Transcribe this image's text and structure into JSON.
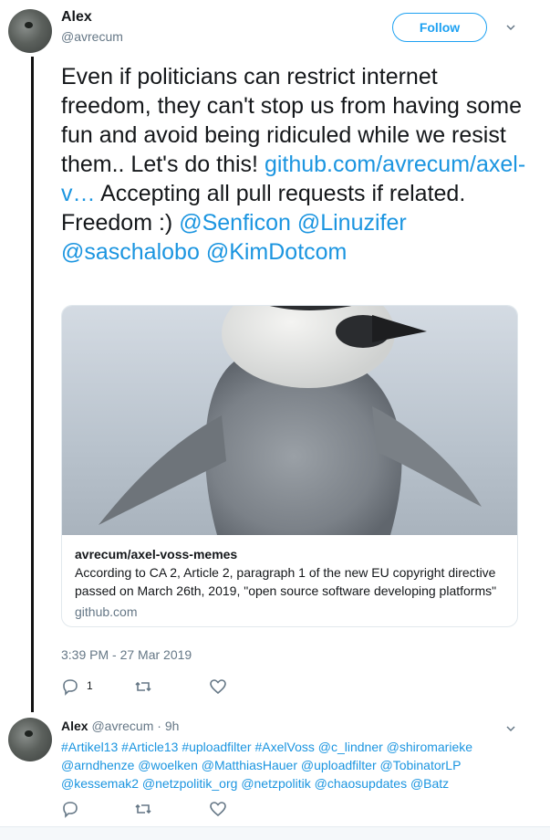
{
  "tweet": {
    "author_name": "Alex",
    "author_handle": "@avrecum",
    "follow_label": "Follow",
    "text_parts": {
      "p1": "Even if politicians can restrict internet freedom, they can't stop us from having some fun and avoid being ridiculed while we resist them.. Let's do this! ",
      "link": "github.com/avrecum/axel-v…",
      "p2": " Accepting all pull requests if related. Freedom :) ",
      "mention1": "@Senficon",
      "mention2": "@Linuzifer",
      "mention3": "@saschalobo",
      "mention4": "@KimDotcom"
    },
    "card": {
      "title": "avrecum/axel-voss-memes",
      "description": "According to CA 2, Article 2, paragraph 1 of the new EU copyright directive passed on March 26th, 2019, \"open source software developing platforms\"",
      "domain": "github.com"
    },
    "timestamp": "3:39 PM - 27 Mar 2019",
    "reply_count": "1",
    "icons": [
      "reply-icon",
      "retweet-icon",
      "like-icon",
      "chevron-down-icon"
    ]
  },
  "reply": {
    "author_name": "Alex",
    "author_handle": "@avrecum",
    "separator": " · ",
    "time": "9h",
    "tags": [
      "#Artikel13",
      "#Article13",
      "#uploadfilter",
      "#AxelVoss",
      "@c_lindner",
      "@shiromarieke",
      "@arndhenze",
      "@woelken",
      "@MatthiasHauer",
      "@uploadfilter",
      "@TobinatorLP",
      "@kessemak2",
      "@netzpolitik_org",
      "@netzpolitik",
      "@chaosupdates",
      "@Batz"
    ]
  },
  "colors": {
    "accent": "#1da1f2",
    "link": "#1b95e0",
    "muted": "#657786",
    "text": "#14171a",
    "border": "#e1e8ed"
  }
}
